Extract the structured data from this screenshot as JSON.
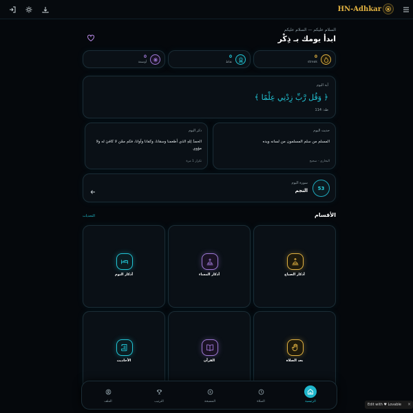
{
  "app": {
    "brand": "HN-Adhkar",
    "colors": {
      "accent": "#22c7d8",
      "gold": "#e3b341",
      "purple": "#a07ad8",
      "bg": "#05080c"
    }
  },
  "topbar": {
    "icons": [
      "login-icon",
      "sun-icon",
      "download-icon",
      "menu-icon",
      "brand-logo-icon"
    ]
  },
  "greeting": {
    "subtitle": "السلام عليكم — السلام عليكم",
    "title": "ابدأ يومك بـ ذِكْر"
  },
  "stats": [
    {
      "value": "0",
      "label": "streak",
      "icon": "flame-icon",
      "color": "#e3b341"
    },
    {
      "value": "0",
      "label": "نقاط",
      "icon": "star-icon",
      "color": "#22c7d8"
    },
    {
      "value": "0",
      "label": "أوسمة",
      "icon": "sparkle-icon",
      "color": "#a07ad8"
    }
  ],
  "verse": {
    "heading": "آية اليوم",
    "text": "﴿ وَقُل رَّبِّ زِدْنِي عِلْمًا ﴾",
    "reference": "طه: 114"
  },
  "hadith": {
    "heading": "حديث اليوم",
    "text": "المسلم من سلم المسلمون من لسانه ويده",
    "source": "البخاري - صحيح"
  },
  "dhikr": {
    "heading": "ذكر اليوم",
    "text": "الحمدُ لِلهِ الذي أطعمنا وسقانا، وكفانا وآوانا، فكم ممّن لا كافيَ له ولا مؤوي",
    "repeat": "تكرار 1 مرة"
  },
  "surah": {
    "heading": "سورة اليوم",
    "name": "النجم",
    "number": "53"
  },
  "sections": {
    "title": "الأقسام",
    "link": "التحديات",
    "items": [
      {
        "label": "أذكار الصباح",
        "icon": "sunrise-icon",
        "color": "#e3b341"
      },
      {
        "label": "أذكار المساء",
        "icon": "sunset-icon",
        "color": "#a07ad8"
      },
      {
        "label": "أذكار النوم",
        "icon": "bed-icon",
        "color": "#22c7d8"
      },
      {
        "label": "بعد الصلاة",
        "icon": "hand-icon",
        "color": "#e3b341"
      },
      {
        "label": "القرآن",
        "icon": "book-icon",
        "color": "#a07ad8"
      },
      {
        "label": "الأحاديث",
        "icon": "scroll-icon",
        "color": "#22c7d8"
      }
    ]
  },
  "nav": [
    {
      "label": "الرئيسية",
      "icon": "home-icon",
      "active": true
    },
    {
      "label": "الصلاة",
      "icon": "clock-icon",
      "active": false
    },
    {
      "label": "المسبحة",
      "icon": "circle-icon",
      "active": false
    },
    {
      "label": "الترتيب",
      "icon": "trophy-icon",
      "active": false
    },
    {
      "label": "الملف",
      "icon": "user-icon",
      "active": false
    }
  ],
  "badge": {
    "text": "Edit with ♥ Lovable",
    "close": "×"
  }
}
